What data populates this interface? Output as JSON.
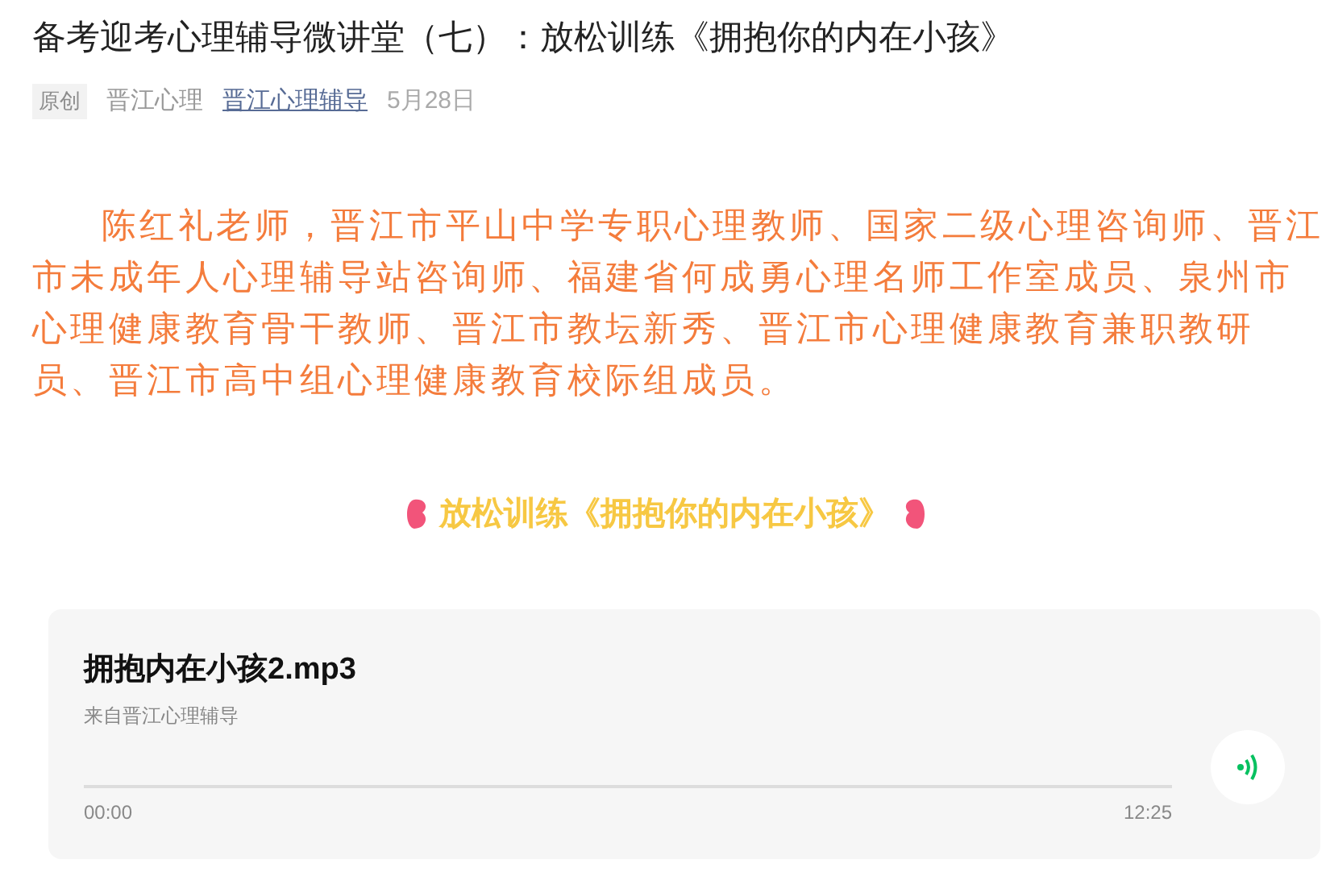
{
  "article": {
    "title": "备考迎考心理辅导微讲堂（七）：放松训练《拥抱你的内在小孩》",
    "meta": {
      "badge": "原创",
      "author": "晋江心理",
      "account": "晋江心理辅导",
      "date": "5月28日"
    },
    "intro_lines": [
      "陈红礼老师，晋江市平山中学专职心理教师、国家二级心理咨询师、晋江",
      "市未成年人心理辅导站咨询师、福建省何成勇心理名师工作室成员、泉州市",
      "心理健康教育骨干教师、晋江市教坛新秀、晋江市心理健康教育兼职教研",
      "员、晋江市高中组心理健康教育校际组成员。"
    ],
    "section_heading": "放松训练《拥抱你的内在小孩》"
  },
  "audio": {
    "title": "拥抱内在小孩2.mp3",
    "source": "来自晋江心理辅导",
    "current": "00:00",
    "duration": "12:25",
    "playing": false
  }
}
